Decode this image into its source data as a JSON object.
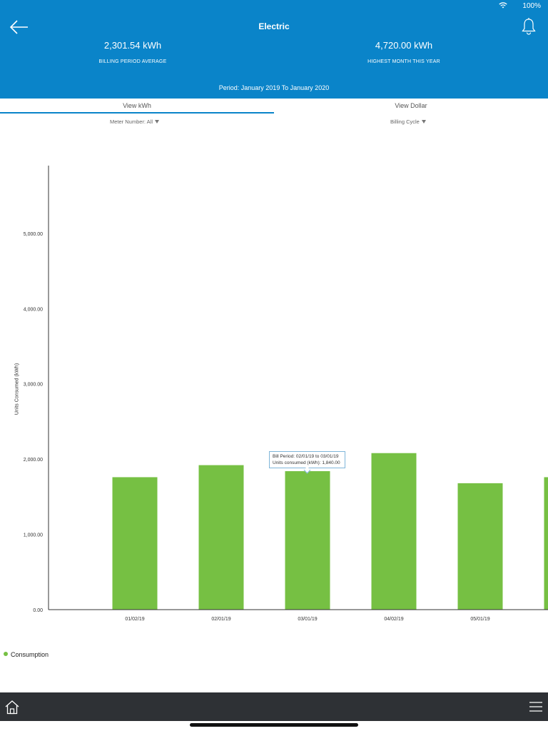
{
  "status_bar": {
    "battery": "100%"
  },
  "header": {
    "title": "Electric",
    "stats": [
      {
        "value": "2,301.54 kWh",
        "label": "BILLING PERIOD AVERAGE"
      },
      {
        "value": "4,720.00 kWh",
        "label": "HIGHEST MONTH THIS YEAR"
      }
    ],
    "period": "Period: January 2019 To January 2020"
  },
  "tabs": [
    {
      "label": "View kWh",
      "active": true
    },
    {
      "label": "View Dollar",
      "active": false
    }
  ],
  "filters": {
    "meter": "Meter Number: All",
    "cycle": "Billing Cycle"
  },
  "tooltip": {
    "line1": "Bill Period: 02/01/19 to 03/01/19",
    "line2": "Units consumed (kWh): 1,840.00"
  },
  "colors": {
    "header": "#0a84c9",
    "bar": "#76c043",
    "bottom_bar": "#2e3135"
  },
  "icons": [
    "back-arrow-icon",
    "bell-icon",
    "wifi-icon",
    "home-icon",
    "hamburger-menu-icon"
  ],
  "chart_data": {
    "type": "bar",
    "categories": [
      "01/02/19",
      "02/01/19",
      "03/01/19",
      "04/02/19",
      "05/01/19",
      ""
    ],
    "series": [
      {
        "name": "Consumption",
        "values": [
          1760,
          1920,
          1840,
          2080,
          1680,
          1760
        ]
      }
    ],
    "ylabel": "Units Consumed (kWh)",
    "y_ticks": [
      "0.00",
      "1,000.00",
      "2,000.00",
      "3,000.00",
      "4,000.00",
      "5,000.00"
    ],
    "ylim": [
      0,
      5900
    ],
    "grid": false,
    "legend": "bottom-left"
  }
}
